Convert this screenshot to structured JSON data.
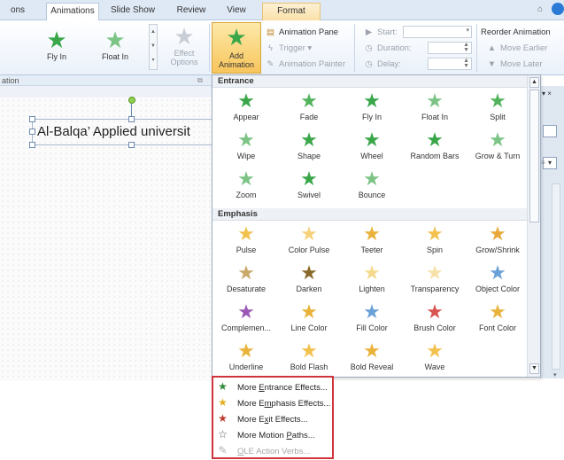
{
  "tabs": [
    "ons",
    "Animations",
    "Slide Show",
    "Review",
    "View",
    "Format"
  ],
  "ribbon": {
    "fly_in": "Fly In",
    "float_in": "Float In",
    "effect_options_1": "Effect",
    "effect_options_2": "Options",
    "add_animation_1": "Add",
    "add_animation_2": "Animation",
    "animation_pane": "Animation Pane",
    "trigger": "Trigger",
    "animation_painter": "Animation Painter",
    "start_label": "Start:",
    "duration_label": "Duration:",
    "delay_label": "Delay:",
    "reorder_title": "Reorder Animation",
    "move_earlier": "Move Earlier",
    "move_later": "Move Later"
  },
  "group_label": "ation",
  "slide": {
    "title_text": "Al-Balqa’ Applied universit"
  },
  "gallery": {
    "entrance_header": "Entrance",
    "emphasis_header": "Emphasis",
    "entrance": [
      {
        "label": "Appear",
        "icon": "appear-star",
        "color": "#3aa64a"
      },
      {
        "label": "Fade",
        "icon": "fade-star",
        "color": "#52b35d"
      },
      {
        "label": "Fly In",
        "icon": "fly-in-star",
        "color": "#3aa64a"
      },
      {
        "label": "Float In",
        "icon": "float-in-star",
        "color": "#7cc486"
      },
      {
        "label": "Split",
        "icon": "split-star",
        "color": "#52b35d"
      },
      {
        "label": "Wipe",
        "icon": "wipe-star",
        "color": "#7cc486"
      },
      {
        "label": "Shape",
        "icon": "shape-star",
        "color": "#3aa64a"
      },
      {
        "label": "Wheel",
        "icon": "wheel-star",
        "color": "#3aa64a"
      },
      {
        "label": "Random Bars",
        "icon": "random-bars-star",
        "color": "#3aa64a"
      },
      {
        "label": "Grow & Turn",
        "icon": "grow-turn-star",
        "color": "#7cc486"
      },
      {
        "label": "Zoom",
        "icon": "zoom-star",
        "color": "#7cc486"
      },
      {
        "label": "Swivel",
        "icon": "swivel-star",
        "color": "#3aa64a"
      },
      {
        "label": "Bounce",
        "icon": "bounce-star",
        "color": "#7cc486"
      }
    ],
    "emphasis": [
      {
        "label": "Pulse",
        "icon": "pulse-star",
        "color": "#f2c14e"
      },
      {
        "label": "Color Pulse",
        "icon": "color-pulse-star",
        "color": "#f5d27a"
      },
      {
        "label": "Teeter",
        "icon": "teeter-star",
        "color": "#e9b23a"
      },
      {
        "label": "Spin",
        "icon": "spin-star",
        "color": "#f2c14e"
      },
      {
        "label": "Grow/Shrink",
        "icon": "grow-shrink-star",
        "color": "#e9a93a"
      },
      {
        "label": "Desaturate",
        "icon": "desaturate-star",
        "color": "#c9a86a"
      },
      {
        "label": "Darken",
        "icon": "darken-star",
        "color": "#8a6a2a"
      },
      {
        "label": "Lighten",
        "icon": "lighten-star",
        "color": "#f5d98c"
      },
      {
        "label": "Transparency",
        "icon": "transparency-star",
        "color": "#f7e1a8"
      },
      {
        "label": "Object Color",
        "icon": "object-color-star",
        "color": "#6aa0d8"
      },
      {
        "label": "Complemen...",
        "icon": "complementary-star",
        "color": "#9b59b6"
      },
      {
        "label": "Line Color",
        "icon": "line-color-star",
        "color": "#e9b23a"
      },
      {
        "label": "Fill Color",
        "icon": "fill-color-star",
        "color": "#6aa0d8"
      },
      {
        "label": "Brush Color",
        "icon": "brush-color-star",
        "color": "#d9534f"
      },
      {
        "label": "Font Color",
        "icon": "font-color-star",
        "color": "#e9b23a"
      },
      {
        "label": "Underline",
        "icon": "underline-star",
        "color": "#e9b23a"
      },
      {
        "label": "Bold Flash",
        "icon": "bold-flash-star",
        "color": "#f2c14e"
      },
      {
        "label": "Bold Reveal",
        "icon": "bold-reveal-star",
        "color": "#e9b23a"
      },
      {
        "label": "Wave",
        "icon": "wave-star",
        "color": "#f2c14e"
      }
    ]
  },
  "menu": [
    {
      "prefix": "More ",
      "key": "E",
      "suffix": "ntrance Effects...",
      "icon": "entrance-star-icon",
      "color": "#2e8b3a",
      "disabled": false
    },
    {
      "prefix": "More E",
      "key": "m",
      "suffix": "phasis Effects...",
      "icon": "emphasis-star-icon",
      "color": "#e0b020",
      "disabled": false
    },
    {
      "prefix": "More E",
      "key": "x",
      "suffix": "it Effects...",
      "icon": "exit-star-icon",
      "color": "#c0392b",
      "disabled": false
    },
    {
      "prefix": "More Motion ",
      "key": "P",
      "suffix": "aths...",
      "icon": "motion-path-icon",
      "color": "#555555",
      "disabled": false
    },
    {
      "prefix": "",
      "key": "O",
      "suffix": "LE Action Verbs...",
      "icon": "ole-verbs-icon",
      "color": "#b0b0b0",
      "disabled": true
    }
  ]
}
